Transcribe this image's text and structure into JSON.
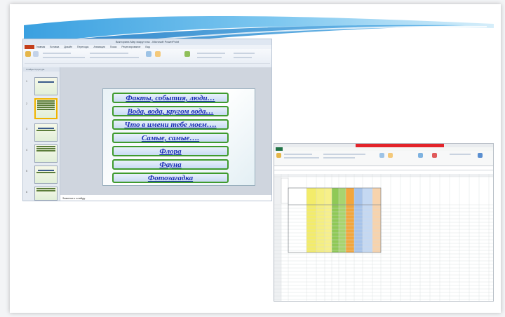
{
  "ppt": {
    "window_title": "Викторина Мир вокруг нас - Microsoft PowerPoint",
    "ribbon_tabs": "Главная Вставка Дизайн Переходы Анимация Показ Рецензирование Вид",
    "sidebar_tabs": "Слайды Структура",
    "status_text": "Заметки к слайду",
    "thumbnail_numbers": [
      "1",
      "2",
      "3",
      "4",
      "5",
      "6"
    ],
    "slide_buttons": [
      "Факты, события, люди…",
      "Вода, вода, кругом вода…",
      "Что в имени тебе моем….",
      "Самые, самые….",
      "Флора",
      "Фауна",
      "Фотозагадка"
    ]
  },
  "excel": {
    "window_title": "Книга1 - Microsoft Excel"
  },
  "colors": {
    "accent_button_border": "#3f9b2e",
    "button_text": "#1d2fb5",
    "ppt_file_tab": "#c4401c",
    "excel_file_tab": "#217346",
    "excel_title_highlight": "#e3232a",
    "col_yellow": "#f3ec6a",
    "col_green": "#8fc956",
    "col_orange": "#f2a63d",
    "col_blue": "#a7c3ea",
    "col_peach": "#f7d3ad"
  }
}
